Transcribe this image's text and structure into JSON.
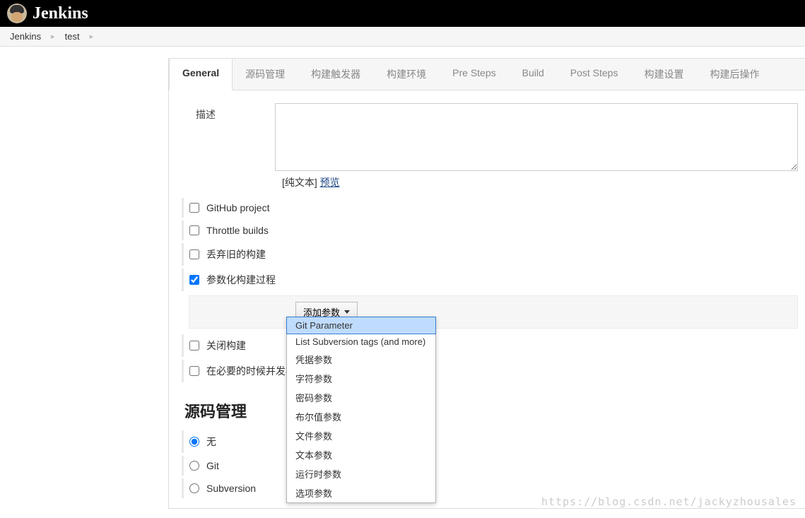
{
  "header": {
    "brand": "Jenkins"
  },
  "breadcrumb": {
    "items": [
      "Jenkins",
      "test"
    ]
  },
  "tabs": [
    {
      "label": "General",
      "active": true
    },
    {
      "label": "源码管理"
    },
    {
      "label": "构建触发器"
    },
    {
      "label": "构建环境"
    },
    {
      "label": "Pre Steps"
    },
    {
      "label": "Build"
    },
    {
      "label": "Post Steps"
    },
    {
      "label": "构建设置"
    },
    {
      "label": "构建后操作"
    }
  ],
  "general": {
    "desc_label": "描述",
    "format_hint_prefix": "[纯文本] ",
    "preview_link": "预览",
    "options": [
      {
        "label": "GitHub project",
        "checked": false
      },
      {
        "label": "Throttle builds",
        "checked": false
      },
      {
        "label": "丢弃旧的构建",
        "checked": false
      },
      {
        "label": "参数化构建过程",
        "checked": true
      },
      {
        "label": "关闭构建",
        "checked": false
      },
      {
        "label": "在必要的时候并发构建",
        "checked": false
      }
    ],
    "add_param_label": "添加参数"
  },
  "param_dropdown": {
    "items": [
      "Git Parameter",
      "List Subversion tags (and more)",
      "凭据参数",
      "字符参数",
      "密码参数",
      "布尔值参数",
      "文件参数",
      "文本参数",
      "运行时参数",
      "选项参数"
    ],
    "highlighted_index": 0
  },
  "scm": {
    "heading": "源码管理",
    "options": [
      {
        "label": "无",
        "checked": true
      },
      {
        "label": "Git",
        "checked": false
      },
      {
        "label": "Subversion",
        "checked": false
      }
    ]
  },
  "watermark": "https://blog.csdn.net/jackyzhousales"
}
